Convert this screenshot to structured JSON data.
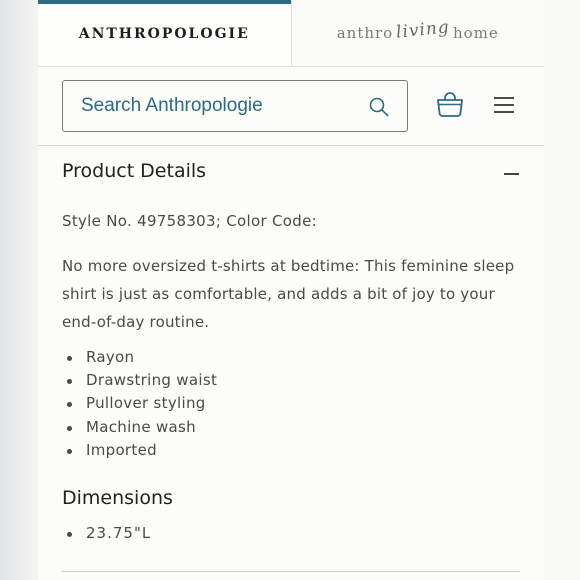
{
  "brand_tabs": {
    "anthropologie": "ANTHROPOLOGIE",
    "living_part1": "anthro",
    "living_part2": "living",
    "living_part3": "home"
  },
  "search": {
    "placeholder": "Search Anthropologie"
  },
  "product_details": {
    "title": "Product Details",
    "style_line": "Style No. 49758303; Color Code:",
    "description": "No more oversized t-shirts at bedtime: This feminine sleep shirt is just as comfortable, and adds a bit of joy to your end-of-day routine.",
    "features": [
      "Rayon",
      "Drawstring waist",
      "Pullover styling",
      "Machine wash",
      "Imported"
    ]
  },
  "dimensions": {
    "title": "Dimensions",
    "items": [
      "23.75\"L"
    ]
  },
  "colors": {
    "accent": "#2c6b86",
    "text": "#4a4a4a"
  },
  "icons": [
    "search-icon",
    "bag-icon",
    "menu-icon",
    "collapse-icon"
  ]
}
